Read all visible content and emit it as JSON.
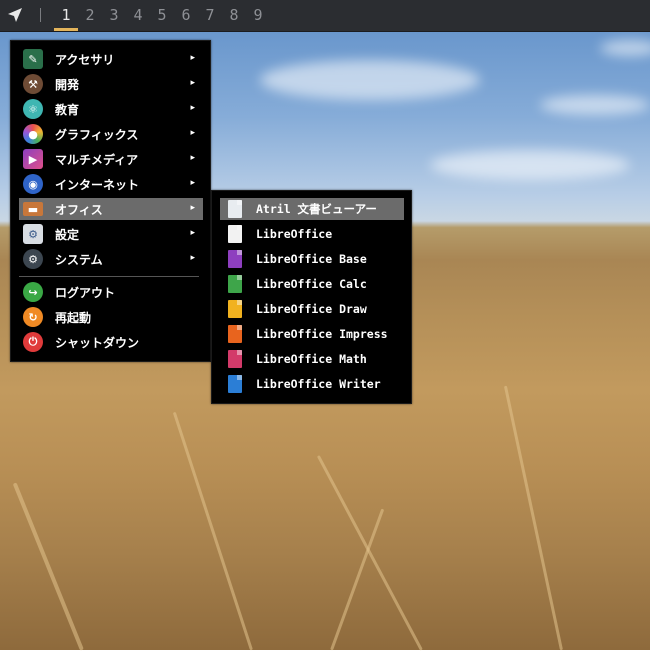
{
  "panel": {
    "launcher_icon": "paper-plane-icon",
    "workspaces": [
      "1",
      "2",
      "3",
      "4",
      "5",
      "6",
      "7",
      "8",
      "9"
    ],
    "active_workspace": "1",
    "accent": "#e3b45b"
  },
  "main_menu": {
    "items": [
      {
        "label": "アクセサリ",
        "icon": "accessories-icon",
        "has_submenu": true
      },
      {
        "label": "開発",
        "icon": "development-icon",
        "has_submenu": true
      },
      {
        "label": "教育",
        "icon": "education-icon",
        "has_submenu": true
      },
      {
        "label": "グラフィックス",
        "icon": "graphics-icon",
        "has_submenu": true
      },
      {
        "label": "マルチメディア",
        "icon": "multimedia-icon",
        "has_submenu": true
      },
      {
        "label": "インターネット",
        "icon": "internet-icon",
        "has_submenu": true
      },
      {
        "label": "オフィス",
        "icon": "office-icon",
        "has_submenu": true,
        "highlighted": true
      },
      {
        "label": "設定",
        "icon": "settings-icon",
        "has_submenu": true
      },
      {
        "label": "システム",
        "icon": "system-icon",
        "has_submenu": true
      }
    ],
    "session_items": [
      {
        "label": "ログアウト",
        "icon": "logout-icon"
      },
      {
        "label": "再起動",
        "icon": "restart-icon"
      },
      {
        "label": "シャットダウン",
        "icon": "shutdown-icon"
      }
    ],
    "arrow": "▸"
  },
  "office_submenu": {
    "items": [
      {
        "label": "Atril 文書ビューアー",
        "icon": "document-viewer-icon",
        "highlighted": true
      },
      {
        "label": "LibreOffice",
        "icon": "libreoffice-icon"
      },
      {
        "label": "LibreOffice Base",
        "icon": "libreoffice-base-icon"
      },
      {
        "label": "LibreOffice Calc",
        "icon": "libreoffice-calc-icon"
      },
      {
        "label": "LibreOffice Draw",
        "icon": "libreoffice-draw-icon"
      },
      {
        "label": "LibreOffice Impress",
        "icon": "libreoffice-impress-icon"
      },
      {
        "label": "LibreOffice Math",
        "icon": "libreoffice-math-icon"
      },
      {
        "label": "LibreOffice Writer",
        "icon": "libreoffice-writer-icon"
      }
    ]
  },
  "colors": {
    "menu_bg": "#000000",
    "highlight": "#6b6b6b",
    "panel_bg": "#2b2d31"
  }
}
